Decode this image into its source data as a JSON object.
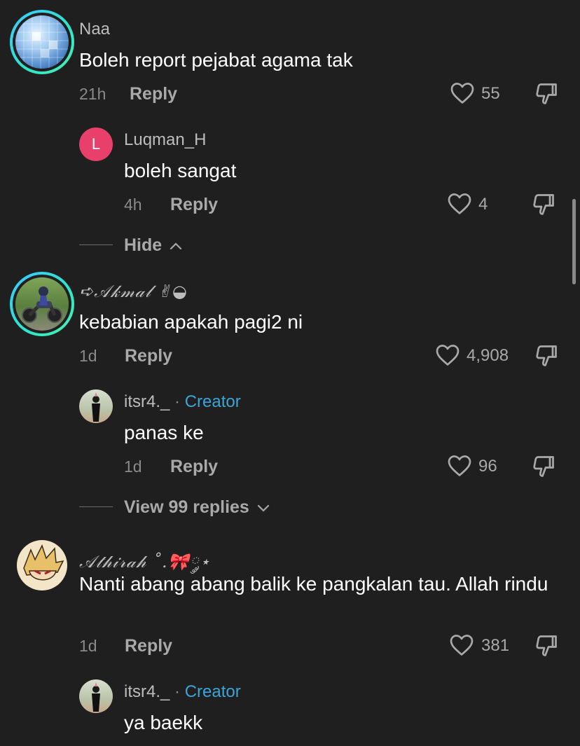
{
  "comments": [
    {
      "username": "Naa",
      "text": "Boleh report pejabat agama tak",
      "time": "21h",
      "reply_label": "Reply",
      "likes": "55",
      "avatar": "disco-ball-avatar"
    },
    {
      "username": "Luqman_H",
      "avatar_letter": "L",
      "text": "boleh sangat",
      "time": "4h",
      "reply_label": "Reply",
      "likes": "4"
    },
    {
      "username": "➪𝒜𝓀𝓂𝒶𝓁 ✌︎◒",
      "text": "kebabian apakah pagi2 ni",
      "time": "1d",
      "reply_label": "Reply",
      "likes": "4,908",
      "avatar": "motorbike-avatar"
    },
    {
      "username": "itsr4._",
      "separator": "·",
      "badge": "Creator",
      "text": "panas ke",
      "time": "1d",
      "reply_label": "Reply",
      "likes": "96"
    },
    {
      "username": "𝒜𝓉𝒽𝒾𝓇𝒶𝒽 ˚.🎀༘⋆",
      "text": "Nanti abang abang balik ke pangkalan tau. Allah rindu",
      "time": "1d",
      "reply_label": "Reply",
      "likes": "381",
      "avatar": "anime-avatar"
    },
    {
      "username": "itsr4._",
      "separator": "·",
      "badge": "Creator",
      "text": "ya baekk"
    }
  ],
  "toggles": {
    "hide_label": "Hide",
    "view_replies_label": "View 99 replies"
  },
  "colors": {
    "background": "#1f1f1f",
    "creator_badge": "#3aa5d8",
    "avatar_letter_bg": "#e9406b",
    "ring_gradient": "#3cc8ff"
  }
}
